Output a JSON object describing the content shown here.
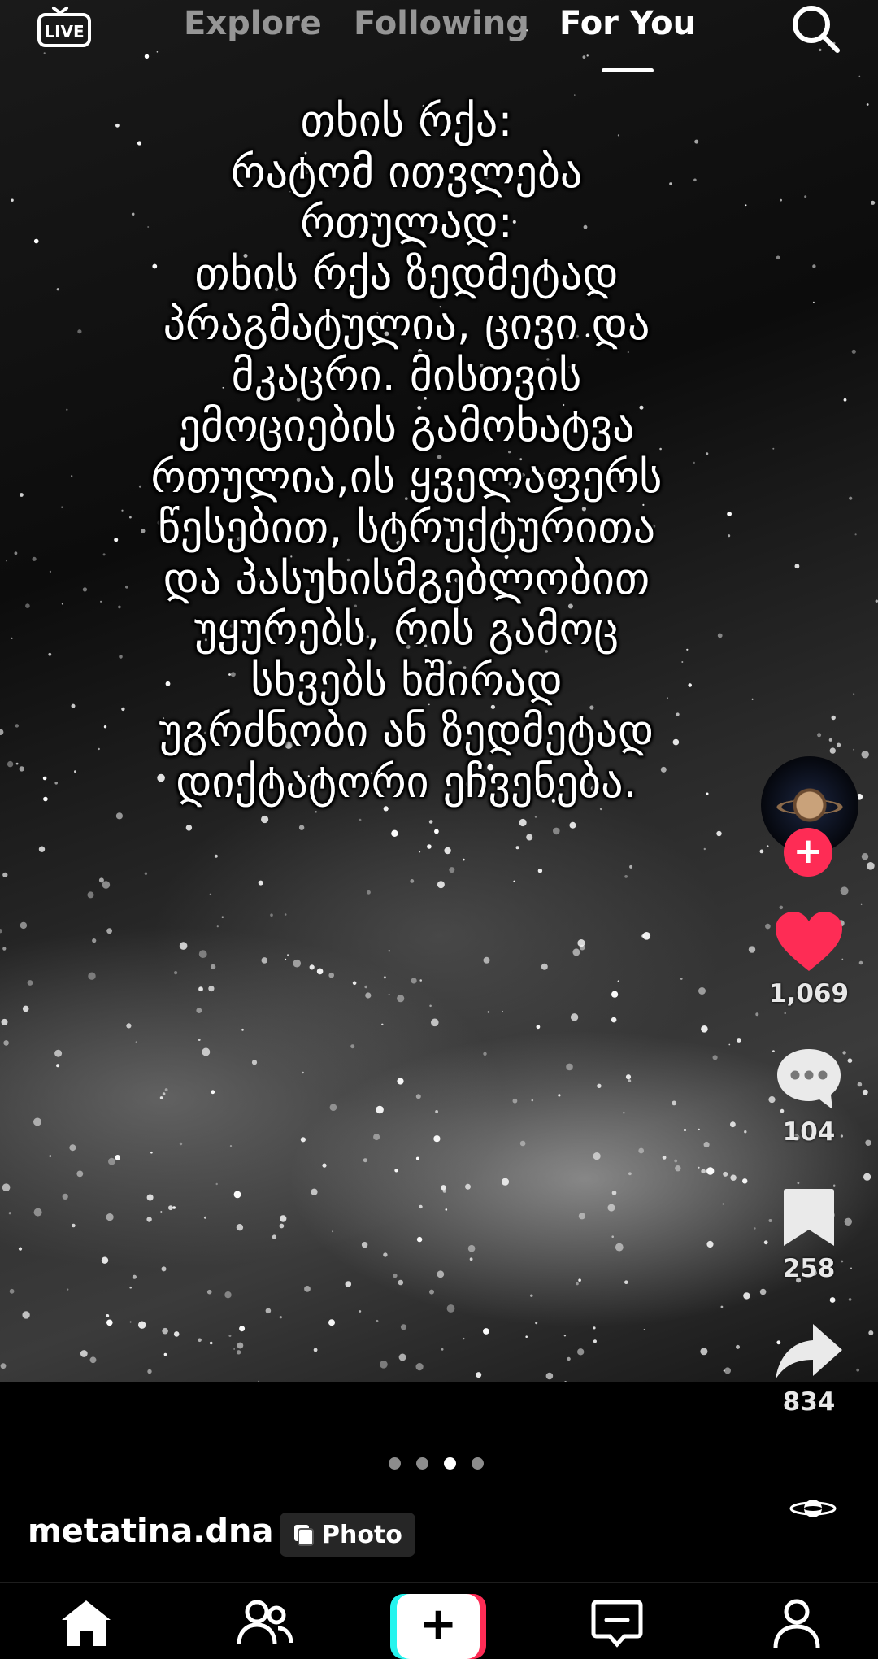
{
  "top_nav": {
    "live_label": "LIVE",
    "tabs": [
      "Explore",
      "Following",
      "For You"
    ],
    "active_tab": "For You"
  },
  "caption": {
    "lines": [
      "თხის რქა:",
      "რატომ ითვლება",
      "რთულად:",
      "თხის რქა ზედმეტად",
      "პრაგმატულია, ცივი და",
      "მკაცრი. მისთვის",
      "ემოციების გამოხატვა",
      "რთულია,ის ყველაფერს",
      "წესებით, სტრუქტურითა",
      "და პასუხისმგებლობით",
      "უყურებს, რის გამოც",
      "სხვებს ხშირად",
      "უგრძნობი ან ზედმეტად",
      "დიქტატორი ეჩვენება."
    ]
  },
  "actions": {
    "follow": "+",
    "likes": "1,069",
    "comments": "104",
    "saves": "258",
    "shares": "834"
  },
  "carousel": {
    "count": 4,
    "active_index": 2
  },
  "post": {
    "username": "metatina.dna",
    "badge": "Photo"
  },
  "bottom_nav": {
    "items": [
      "home-icon",
      "friends-icon",
      "create-button",
      "inbox-icon",
      "profile-icon"
    ]
  },
  "colors": {
    "accent_red": "#fe2c55",
    "accent_cyan": "#25f4ee",
    "background": "#000000"
  }
}
